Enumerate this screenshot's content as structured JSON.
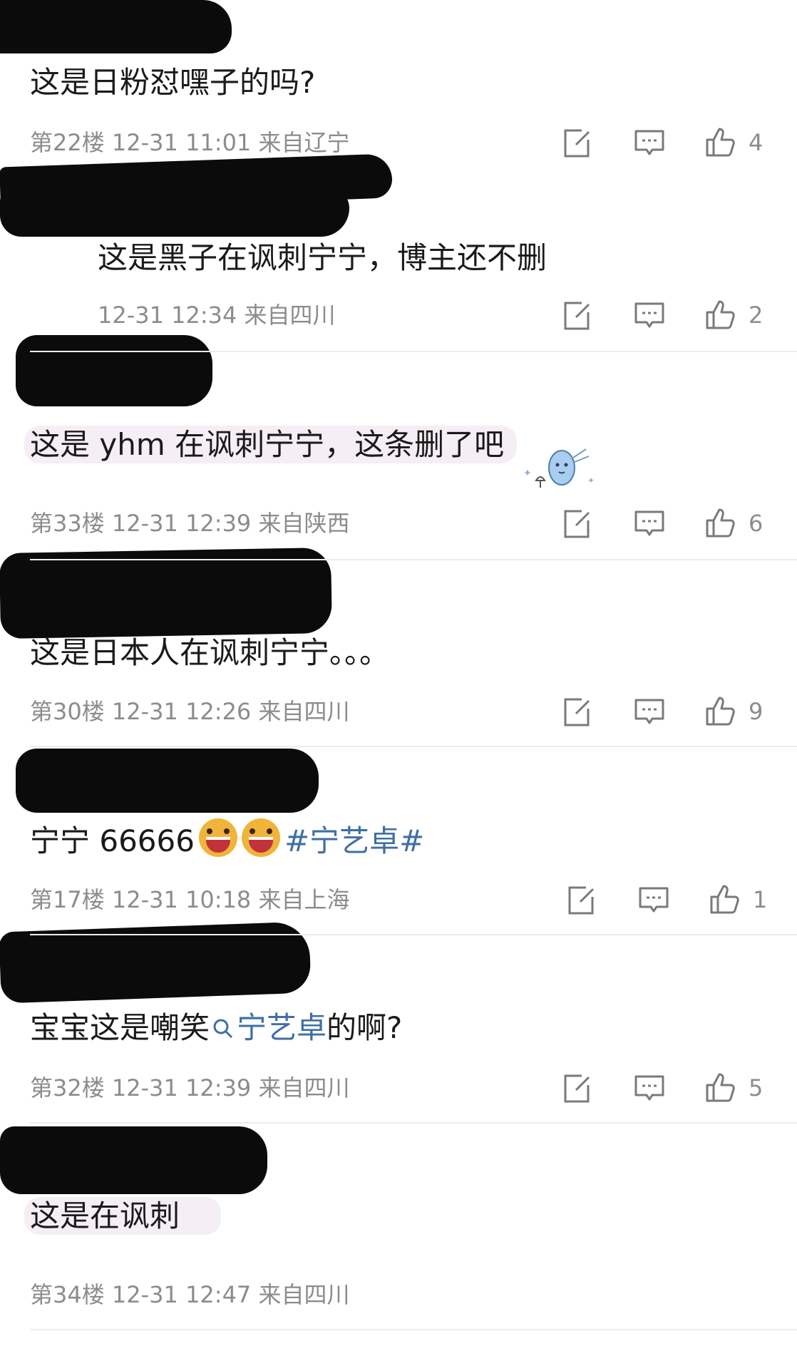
{
  "comments": [
    {
      "text": "这是日粉怼嘿子的吗?",
      "floor": "第22楼",
      "time": "12-31 11:01",
      "location": "来自辽宁",
      "likes": "4"
    },
    {
      "text": "这是黑子在讽刺宁宁，博主还不删",
      "floor": "",
      "time": "12-31 12:34",
      "location": "来自四川",
      "likes": "2"
    },
    {
      "text": "这是 yhm 在讽刺宁宁，这条删了吧",
      "floor": "第33楼",
      "time": "12-31 12:39",
      "location": "来自陕西",
      "likes": "6"
    },
    {
      "text": "这是日本人在讽刺宁宁。。。",
      "floor": "第30楼",
      "time": "12-31 12:26",
      "location": "来自四川",
      "likes": "9"
    },
    {
      "text_prefix": "宁宁 66666",
      "topic": "#宁艺卓#",
      "floor": "第17楼",
      "time": "12-31 10:18",
      "location": "来自上海",
      "likes": "1"
    },
    {
      "text_prefix": "宝宝这是嘲笑",
      "search_topic": "宁艺卓",
      "text_suffix": "的啊?",
      "floor": "第32楼",
      "time": "12-31 12:39",
      "location": "来自四川",
      "likes": "5"
    },
    {
      "text": "这是在讽刺",
      "floor": "第34楼",
      "time": "12-31 12:47",
      "location": "来自四川",
      "likes": ""
    }
  ],
  "icons": {
    "forward": "share-edit-icon",
    "reply": "comment-icon",
    "like": "thumbs-up-icon",
    "search": "search-icon",
    "emoji": "laughing-emoji-icon",
    "sticker": "cartoon-sticker"
  },
  "colors": {
    "text": "#1a1a1a",
    "meta": "#8c8c8c",
    "topic_link": "#3f6fa3",
    "bubble": "#f5eef4",
    "redaction": "#0b0b0b"
  }
}
